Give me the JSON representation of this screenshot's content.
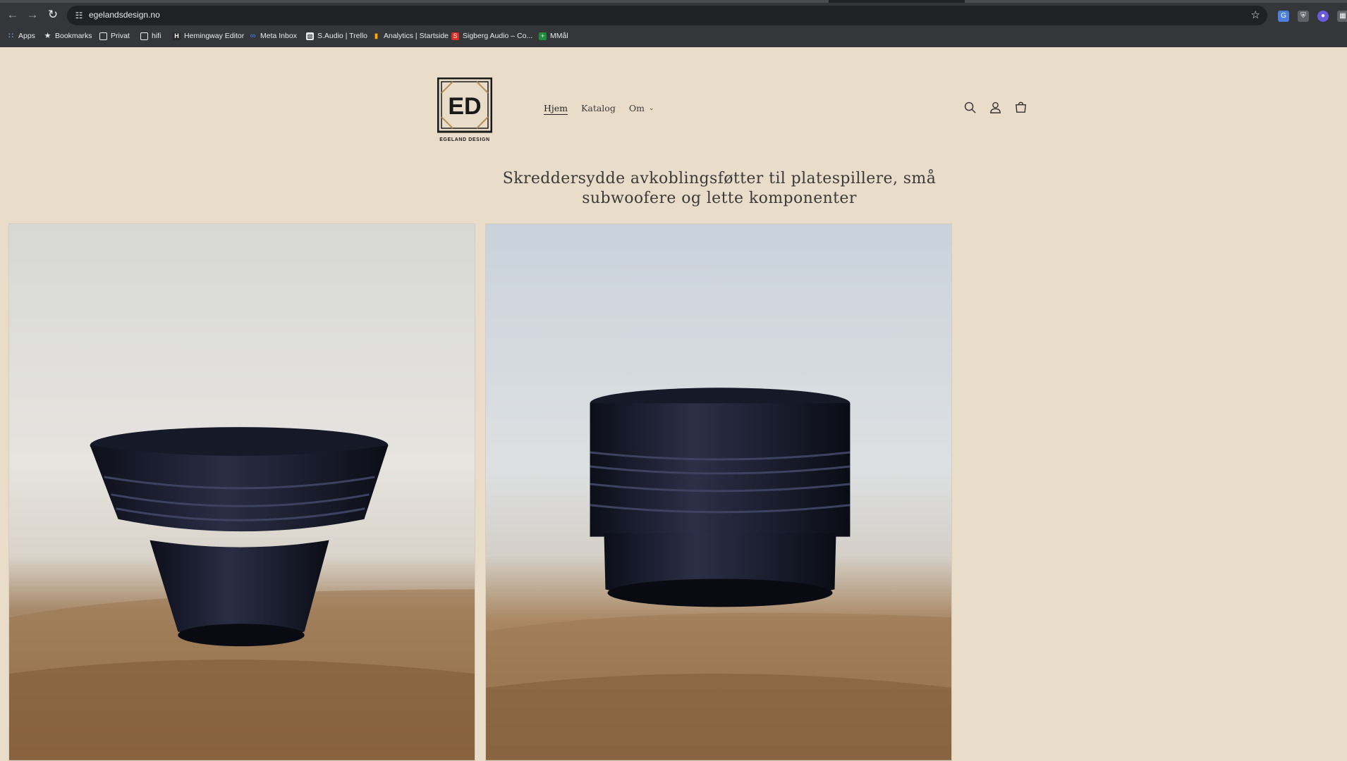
{
  "browser": {
    "url": "egelandsdesign.no",
    "bookmarks": [
      {
        "label": "Apps",
        "icon": "apps-grid-icon"
      },
      {
        "label": "Bookmarks",
        "icon": "star-icon"
      },
      {
        "label": "Privat",
        "icon": "folder-icon"
      },
      {
        "label": "hifi",
        "icon": "folder-icon"
      },
      {
        "label": "Hemingway Editor",
        "icon": "hemingway-icon"
      },
      {
        "label": "Meta Inbox",
        "icon": "meta-icon"
      },
      {
        "label": "S.Audio | Trello",
        "icon": "trello-icon"
      },
      {
        "label": "Analytics | Startside",
        "icon": "analytics-icon"
      },
      {
        "label": "Sigberg Audio – Co...",
        "icon": "sigberg-icon"
      },
      {
        "label": "MMål",
        "icon": "mmal-icon"
      }
    ]
  },
  "site": {
    "brand": "EGELAND DESIGN",
    "logo_letters": "ED",
    "nav": [
      {
        "label": "Hjem",
        "active": true
      },
      {
        "label": "Katalog",
        "active": false
      },
      {
        "label": "Om",
        "active": false,
        "has_dropdown": true
      }
    ],
    "headline": "Skreddersydde avkoblingsføtter til platespillere, små subwoofere og lette komponenter",
    "colors": {
      "page_bg": "#e9dcc9",
      "text": "#3a3a3a",
      "chrome_bg": "#35363a"
    }
  }
}
